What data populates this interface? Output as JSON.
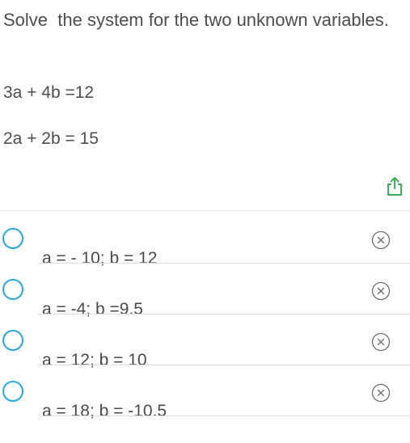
{
  "question": {
    "title": "Solve  the system for the two unknown variables.",
    "equation_1": "3a + 4b =12",
    "equation_2": "2a + 2b = 15"
  },
  "share_icon": "share-icon",
  "colors": {
    "radio_border": "#29a8e0",
    "share_icon": "#3ab25a",
    "text": "#4a4a4a",
    "divider": "#dcdcdc"
  },
  "options": [
    {
      "label": "a = - 10; b = 12",
      "selected": false,
      "remove_icon": "close-circle-icon"
    },
    {
      "label": "a = -4; b =9.5",
      "selected": false,
      "remove_icon": "close-circle-icon"
    },
    {
      "label": "a = 12; b = 10",
      "selected": false,
      "remove_icon": "close-circle-icon"
    },
    {
      "label": "a = 18; b = -10.5",
      "selected": false,
      "remove_icon": "close-circle-icon"
    }
  ]
}
